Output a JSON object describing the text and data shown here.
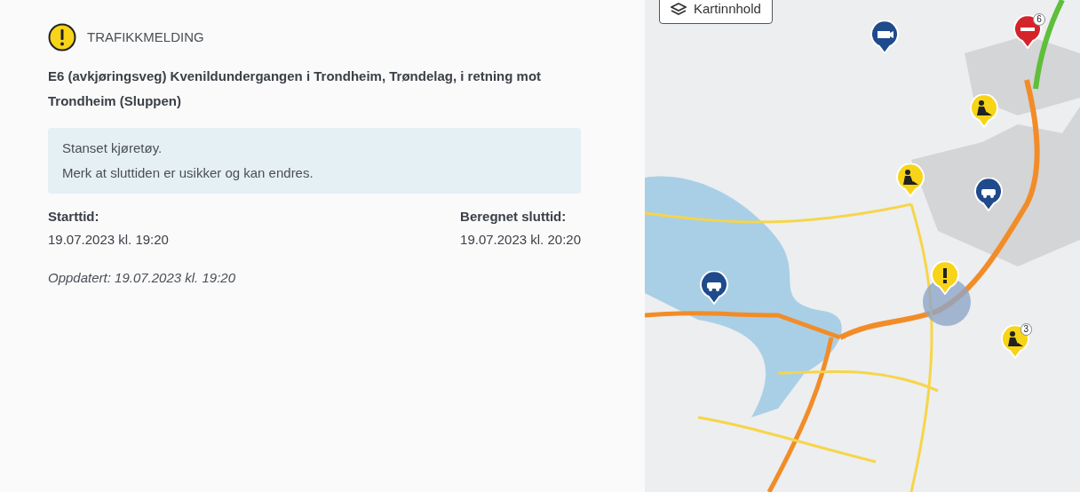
{
  "message": {
    "category": "TRAFIKKMELDING",
    "title": "E6 (avkjøringsveg) Kvenildundergangen i Trondheim, Trøndelag, i retning mot Trondheim (Sluppen)",
    "notes": [
      "Stanset kjøretøy.",
      "Merk at sluttiden er usikker og kan endres."
    ],
    "times": [
      {
        "label": "Starttid:",
        "value": "19.07.2023 kl. 19:20"
      },
      {
        "label": "Beregnet sluttid:",
        "value": "19.07.2023 kl. 20:20"
      }
    ],
    "updated": "Oppdatert: 19.07.2023 kl. 19:20"
  },
  "map": {
    "button": "Kartinnhold",
    "markers": [
      {
        "kind": "warning"
      },
      {
        "kind": "roadwork"
      },
      {
        "kind": "roadwork"
      },
      {
        "kind": "roadwork",
        "count": "3"
      },
      {
        "kind": "camera"
      },
      {
        "kind": "vehicle"
      },
      {
        "kind": "vehicle"
      },
      {
        "kind": "closed",
        "count": "6"
      }
    ]
  }
}
